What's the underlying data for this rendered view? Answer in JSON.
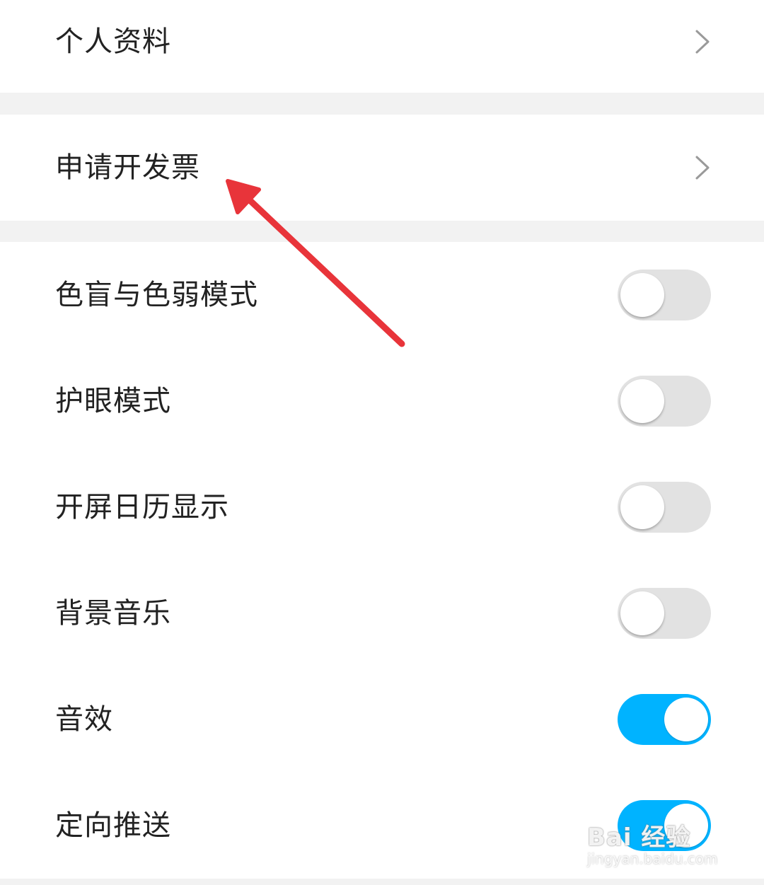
{
  "rows_nav": [
    {
      "label": "个人资料"
    },
    {
      "label": "申请开发票"
    }
  ],
  "rows_toggle": [
    {
      "label": "色盲与色弱模式",
      "on": false
    },
    {
      "label": "护眼模式",
      "on": false
    },
    {
      "label": "开屏日历显示",
      "on": false
    },
    {
      "label": "背景音乐",
      "on": false
    },
    {
      "label": "音效",
      "on": true
    },
    {
      "label": "定向推送",
      "on": true
    }
  ],
  "icons": {
    "nav_arrow": "chevron-right-icon",
    "annotation": "red-arrow-icon"
  },
  "colors": {
    "toggle_on": "#00b3ff",
    "toggle_off": "#e2e2e2",
    "annotation_arrow": "#e8343a"
  },
  "watermark": {
    "logo": "Bai 经验",
    "url": "jingyan.baidu.com"
  }
}
